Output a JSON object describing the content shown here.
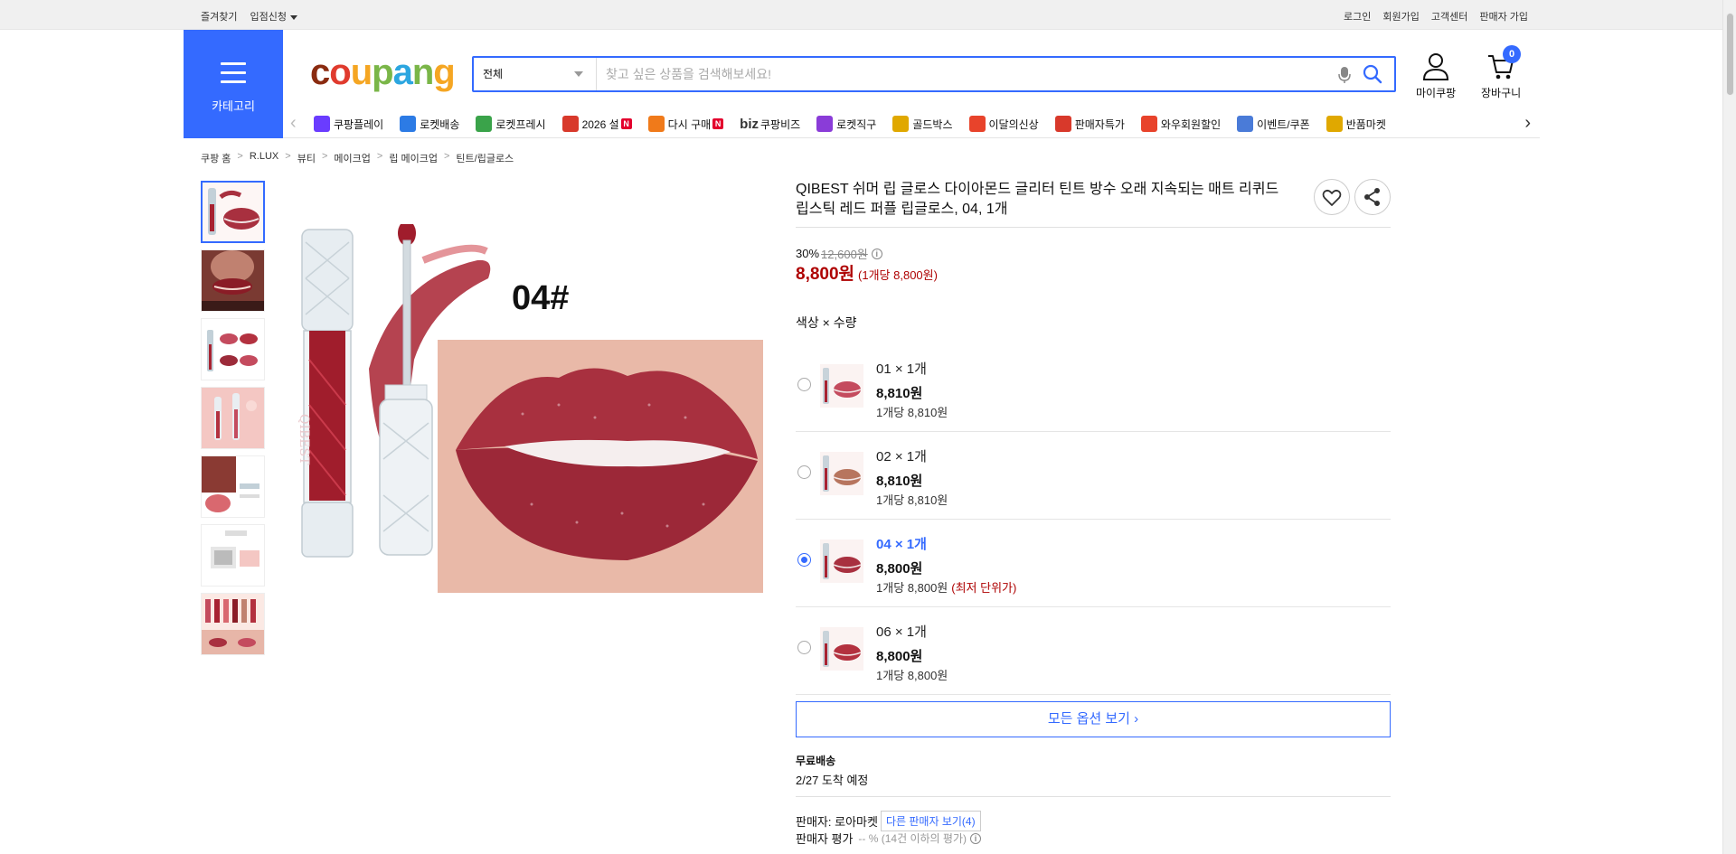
{
  "topbar": {
    "favorites": "즐겨찾기",
    "seller_apply": "입점신청",
    "login": "로그인",
    "signup": "회원가입",
    "customer_center": "고객센터",
    "seller_signup": "판매자 가입"
  },
  "header": {
    "category_label": "카테고리",
    "search_scope": "전체",
    "search_placeholder": "찾고 싶은 상품을 검색해보세요!",
    "my_coupang": "마이쿠팡",
    "cart": "장바구니",
    "cart_count": "0",
    "brand_color": "#346aff"
  },
  "nav": {
    "items": [
      {
        "label": "쿠팡플레이",
        "icon": "play-icon",
        "color": "#6a3cff"
      },
      {
        "label": "로켓배송",
        "icon": "rocket-icon",
        "color": "#2c7be5"
      },
      {
        "label": "로켓프레시",
        "icon": "rocket-fresh-icon",
        "color": "#3aa34a"
      },
      {
        "label": "2026 설",
        "icon": "gift-icon",
        "color": "#d8392b",
        "badge": "N"
      },
      {
        "label": "다시 구매",
        "icon": "home-icon",
        "color": "#f07a1a",
        "badge": "N"
      },
      {
        "label": "쿠팡비즈",
        "icon": "biz-icon",
        "color": "#333333",
        "prefix": "biz"
      },
      {
        "label": "로켓직구",
        "icon": "global-icon",
        "color": "#8a3cd8"
      },
      {
        "label": "골드박스",
        "icon": "goldbox-icon",
        "color": "#e0a800"
      },
      {
        "label": "이달의신상",
        "icon": "new-icon",
        "color": "#e8432b"
      },
      {
        "label": "판매자특가",
        "icon": "percent-icon",
        "color": "#d8392b"
      },
      {
        "label": "와우회원할인",
        "icon": "wow-icon",
        "color": "#e8432b"
      },
      {
        "label": "이벤트/쿠폰",
        "icon": "coupon-icon",
        "color": "#4a7bd8"
      },
      {
        "label": "반품마켓",
        "icon": "market-icon",
        "color": "#e0a800"
      }
    ]
  },
  "breadcrumb": [
    "쿠팡 홈",
    "R.LUX",
    "뷰티",
    "메이크업",
    "립 메이크업",
    "틴트/립글로스"
  ],
  "product": {
    "title": "QIBEST 쉬머 립 글로스 다이아몬드 글리터 틴트 방수 오래 지속되는 매트 리퀴드 립스틱 레드 퍼플 립글로스, 04, 1개",
    "discount_rate": "30%",
    "original_price": "12,600원",
    "price": "8,800원",
    "unit_price": "(1개당 8,800원)",
    "image_label": "04#",
    "option_header": "색상 × 수량",
    "options": [
      {
        "name": "01 × 1개",
        "price": "8,810원",
        "unit": "1개당 8,810원",
        "best": "",
        "selected": false
      },
      {
        "name": "02 × 1개",
        "price": "8,810원",
        "unit": "1개당 8,810원",
        "best": "",
        "selected": false
      },
      {
        "name": "04 × 1개",
        "price": "8,800원",
        "unit": "1개당 8,800원",
        "best": "(최저 단위가)",
        "selected": true
      },
      {
        "name": "06 × 1개",
        "price": "8,800원",
        "unit": "1개당 8,800원",
        "best": "",
        "selected": false
      }
    ],
    "all_options": "모든 옵션 보기",
    "shipping_title": "무료배송",
    "shipping_date": "2/27 도착 예정",
    "seller_label": "판매자: 로아마켓",
    "other_sellers": "다른 판매자 보기(4)",
    "rating_label": "판매자 평가",
    "rating_value": "-- % (14건 이하의 평가)",
    "price_color": "#ae0000"
  }
}
